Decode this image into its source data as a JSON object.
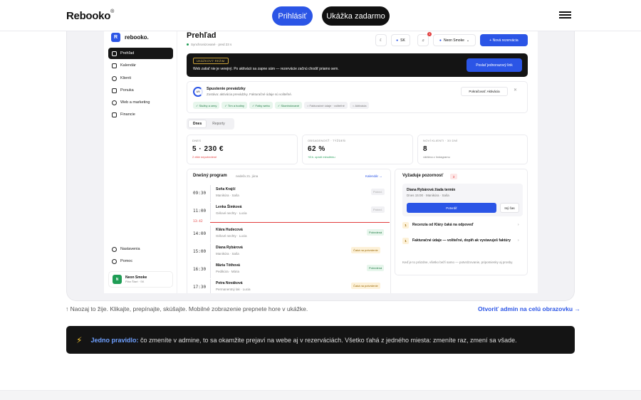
{
  "nav": {
    "logo": "Rebooko",
    "logo_mark": "®",
    "login": "Prihlásiť",
    "demo": "Ukážka zadarmo"
  },
  "sidebar": {
    "brand": "rebooko.",
    "brand_letter": "R",
    "items": [
      {
        "label": "Prehľad",
        "icon": "grid-icon"
      },
      {
        "label": "Kalendár",
        "icon": "calendar-icon"
      },
      {
        "label": "Klienti",
        "icon": "users-icon"
      },
      {
        "label": "Ponuka",
        "icon": "tag-icon"
      },
      {
        "label": "Web a marketing",
        "icon": "globe-icon"
      },
      {
        "label": "Financie",
        "icon": "wallet-icon"
      }
    ],
    "bottom_items": [
      {
        "label": "Nastavenia",
        "icon": "gear-icon"
      },
      {
        "label": "Pomoc",
        "icon": "help-icon"
      }
    ],
    "user": {
      "initial": "N",
      "name": "Neon Smoke",
      "plan": "Plán Štart · SK"
    }
  },
  "header": {
    "title": "Prehľad",
    "sync": "Synchronizované · pred 23 s",
    "lang": "SK",
    "notif_count": "3",
    "account": "Neon Smoke",
    "new_booking": "Nová rezervácia"
  },
  "demo_banner": {
    "tag": "UKÁŽKOVÝ REŽIM",
    "text": "Web zatiaľ nie je verejný. Po aktivácii sa zapne sám — rezervácie začnú chodiť priamo sem.",
    "button": "Poslať jednorazový link"
  },
  "launch": {
    "ring": "4/9",
    "title": "Spustenie prevádzky",
    "subtitle": "Zostáva: aktivácia prevádzky. Fakturačné údaje sú voliteľné.",
    "continue": "Pokračovať: Aktivácia",
    "chips_done": [
      "Služby a ceny",
      "Tím a hodiny",
      "Fotky webu",
      "Skontrolované"
    ],
    "chips_pending": [
      "Fakturačné údaje · voliteľné",
      "Aktivácia"
    ]
  },
  "tabs": [
    "Dnes",
    "Reporty"
  ],
  "stats": [
    {
      "label": "DNES",
      "value": "5 · 230 €",
      "sub": "2 ešte nepotvrdené",
      "sub_color": "#e23b3b"
    },
    {
      "label": "OBSADENOSŤ · TÝŽDEŇ",
      "value": "62 %",
      "sub": "+8 b. oproti minulému",
      "sub_color": "#1f9d55"
    },
    {
      "label": "NOVÍ KLIENTI · 30 DNÍ",
      "value": "8",
      "sub": "väčšina z Instagramu",
      "sub_color": "#777777"
    }
  ],
  "program": {
    "title": "Dnešný program",
    "date": "nedeľa 21. júna",
    "link": "Kalendár →",
    "now": "13:42",
    "rows": [
      {
        "time": "09:30",
        "name": "Soňa Krajčí",
        "service": "Manikúra · Saša",
        "status": "Potvrd.",
        "kind": "gray"
      },
      {
        "time": "11:00",
        "name": "Lenka Šimková",
        "service": "Gélové nechty · Lucia",
        "status": "Potvrd.",
        "kind": "gray"
      },
      {
        "time": "14:00",
        "name": "Klára Hudecová",
        "service": "Gélové nechty · Lucia",
        "status": "Potvrdená",
        "kind": "green"
      },
      {
        "time": "15:00",
        "name": "Diana Rybárová",
        "service": "Manikúra · Saša",
        "status": "Čaká na potvrdenie",
        "kind": "amber"
      },
      {
        "time": "16:30",
        "name": "Mária Tóthová",
        "service": "Pedikúra · Mária",
        "status": "Potvrdená",
        "kind": "green"
      },
      {
        "time": "17:30",
        "name": "Petra Nováková",
        "service": "Permanentný lak · Lucia",
        "status": "Čaká na potvrdenie",
        "kind": "amber"
      }
    ]
  },
  "attention": {
    "title": "Vyžaduje pozornosť",
    "count": "3",
    "box_title": "Diana Rybárová žiada termín",
    "box_sub": "Dnes 15:00 · Manikúra · Saša",
    "confirm": "Potvrdiť",
    "other": "Iný čas",
    "items": [
      {
        "n": "1",
        "text": "Recenzia od Kláry čaká na odpoveď"
      },
      {
        "n": "1",
        "text": "Fakturačné údaje — voliteľné, doplň ak vystavuješ faktúry"
      }
    ],
    "foot": "Keď je to prázdne, všetko beží samo — potvrdzovanie, pripomienky aj prosby."
  },
  "caption": {
    "left": "↑ Naozaj to žije. Klikajte, prepínajte, skúšajte. Mobilné zobrazenie prepnete hore v ukážke.",
    "right": "Otvoriť admin na celú obrazovku →"
  },
  "rule": {
    "lead": "Jedno pravidlo:",
    "text": " čo zmeníte v admine, to sa okamžite prejaví na webe aj v rezerváciách. Všetko ťahá z jedného miesta: zmeníte raz, zmení sa všade."
  },
  "colors": {
    "accent": "#2b55e6",
    "dark": "#141414",
    "danger": "#e23b3b",
    "success": "#1f9d55"
  }
}
